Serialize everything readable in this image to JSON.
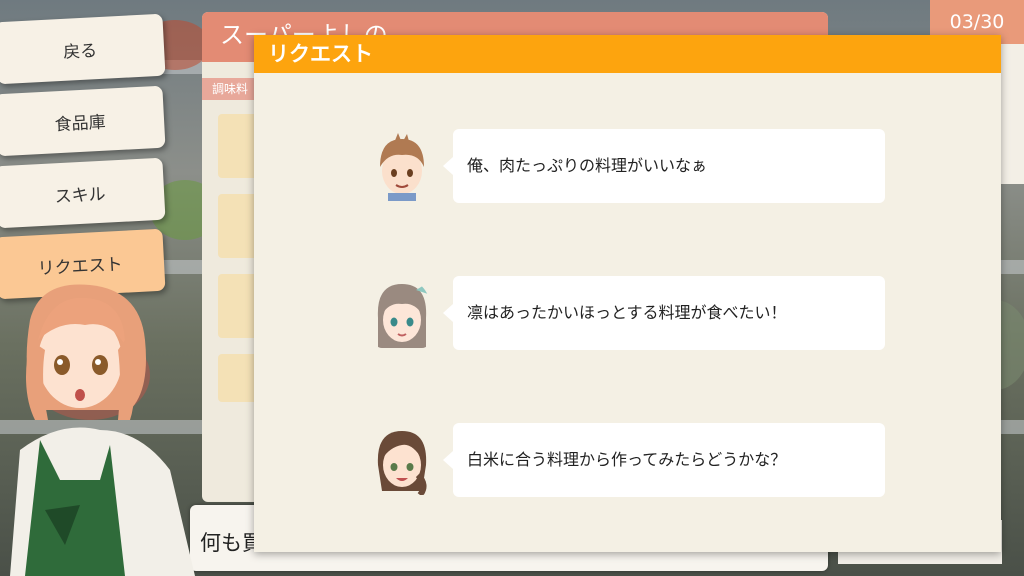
{
  "menu": {
    "items": [
      {
        "label": "戻る",
        "active": false
      },
      {
        "label": "食品庫",
        "active": false
      },
      {
        "label": "スキル",
        "active": false
      },
      {
        "label": "リクエスト",
        "active": true
      }
    ]
  },
  "counter": {
    "text": "03/30"
  },
  "shop": {
    "title": "スーパーよしの",
    "category": "調味料",
    "icons": [
      "pen-icon",
      "text-size-icon",
      "alarm-icon"
    ]
  },
  "dialog": {
    "text": "何も買"
  },
  "modal": {
    "title": "リクエスト",
    "requests": [
      {
        "character": "boy",
        "text": "俺、肉たっぷりの料理がいいなぁ"
      },
      {
        "character": "rin",
        "text": "凛はあったかいほっとする料理が食べたい！"
      },
      {
        "character": "mother",
        "text": "白米に合う料理から作ってみたらどうかな？"
      }
    ]
  },
  "colors": {
    "modal_header": "#fda40e",
    "shop_header": "#e38b74",
    "menu_active": "#fbc894",
    "panel_bg": "#f4f0e4"
  }
}
